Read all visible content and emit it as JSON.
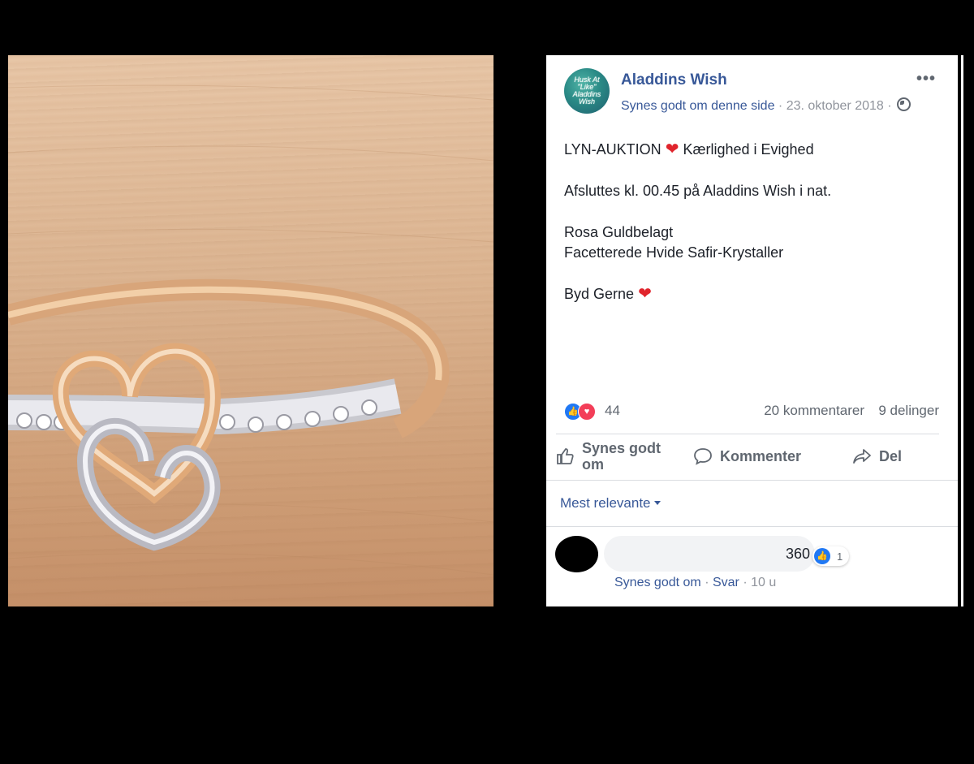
{
  "post": {
    "page_name": "Aladdins Wish",
    "avatar_text": "Husk At \"Like\" Aladdins Wish",
    "like_page": "Synes godt om denne side",
    "date": "23. oktober 2018",
    "more_icon": "•••",
    "lines": [
      "LYN-AUKTION",
      "Kærlighed i Evighed",
      "Afsluttes kl. 00.45 på Aladdins Wish i nat.",
      "Rosa Guldbelagt",
      "Facetterede Hvide Safir-Krystaller",
      "Byd Gerne"
    ],
    "heart_emoji": "❤",
    "reactions_count": "44",
    "comments_count": "20 kommentarer",
    "shares_count": "9 delinger"
  },
  "actions": {
    "like": "Synes godt om",
    "comment": "Kommenter",
    "share": "Del"
  },
  "comments": {
    "sort_label": "Mest relevante",
    "items": [
      {
        "text": "360",
        "like_count": "1",
        "like_label": "Synes godt om",
        "reply_label": "Svar",
        "time": "10 u"
      }
    ]
  },
  "colors": {
    "link": "#385898",
    "like_blue": "#2078f4",
    "love_red": "#f33e58"
  },
  "icons": [
    "ring-photo",
    "more-icon",
    "globe-icon",
    "like-reaction-icon",
    "love-reaction-icon",
    "thumbs-up-icon",
    "comment-icon",
    "share-icon",
    "caret-down-icon"
  ]
}
